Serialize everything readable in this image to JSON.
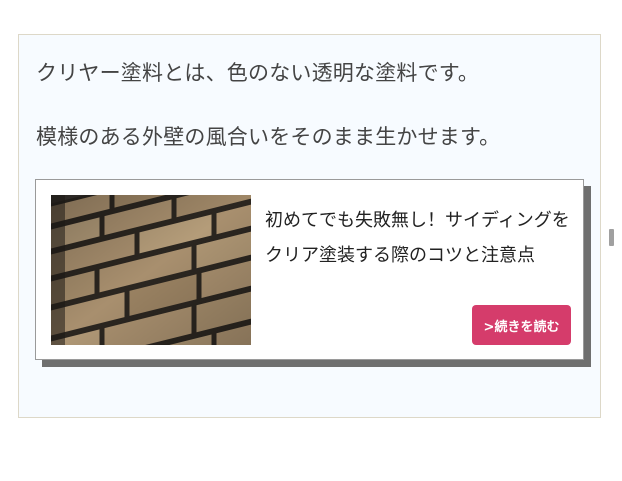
{
  "article": {
    "paragraphs": [
      "クリヤー塗料とは、色のない透明な塗料です。",
      "模様のある外壁の風合いをそのまま生かせます。"
    ]
  },
  "related_card": {
    "title": "初めてでも失敗無し！サイディングをクリア塗装する際のコツと注意点",
    "read_more_label": ">続きを読む",
    "thumbnail": "brick-siding-wall-photo"
  },
  "colors": {
    "box_background": "#f7fbff",
    "box_border": "#ddd8c8",
    "button": "#d53c6b",
    "card_shadow": "#6f6f6f"
  }
}
